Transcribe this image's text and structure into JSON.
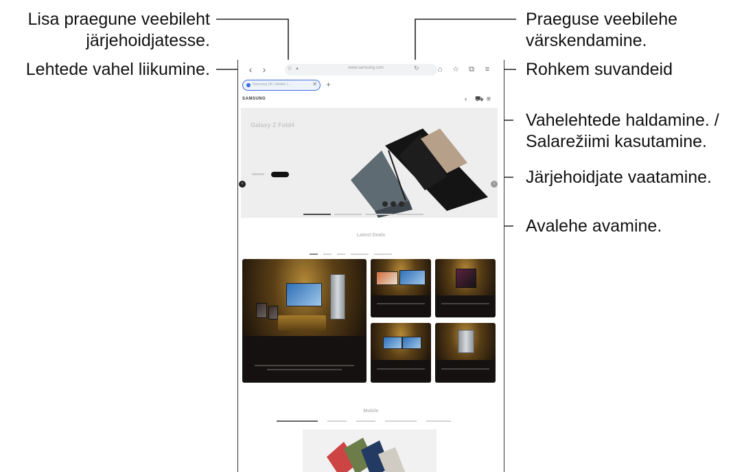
{
  "callouts": {
    "add_bookmark": "Lisa praegune veebileht järjehoidjatesse.",
    "add_bookmark_line1": "Lisa praegune veebileht",
    "add_bookmark_line2": "järjehoidjatesse.",
    "navigate": "Lehtede vahel liikumine.",
    "refresh_line1": "Praeguse veebilehe",
    "refresh_line2": "värskendamine.",
    "more_options": "Rohkem suvandeid",
    "tabs_line1": "Vahelehtede haldamine. /",
    "tabs_line2": "Salarežiimi kasutamine.",
    "view_bookmarks": "Järjehoidjate vaatamine.",
    "home": "Avalehe avamine."
  },
  "browser": {
    "url": "www.samsung.com",
    "tab_title": "Samsung UK | Mobile | ...",
    "icons": {
      "back": "chevron-left-icon",
      "forward": "chevron-right-icon",
      "bookmark_add": "star-icon",
      "refresh": "refresh-icon",
      "home": "home-icon",
      "bookmarks": "bookmark-star-icon",
      "tabs": "tabs-icon",
      "menu": "menu-icon"
    },
    "accent_color": "#3b6fe0"
  },
  "site": {
    "logo": "SAMSUNG",
    "hero_title": "Galaxy Z Fold4",
    "hero_subtitle": "",
    "latest_deals_title": "Latest Deals",
    "mobile_title": "Mobile"
  }
}
